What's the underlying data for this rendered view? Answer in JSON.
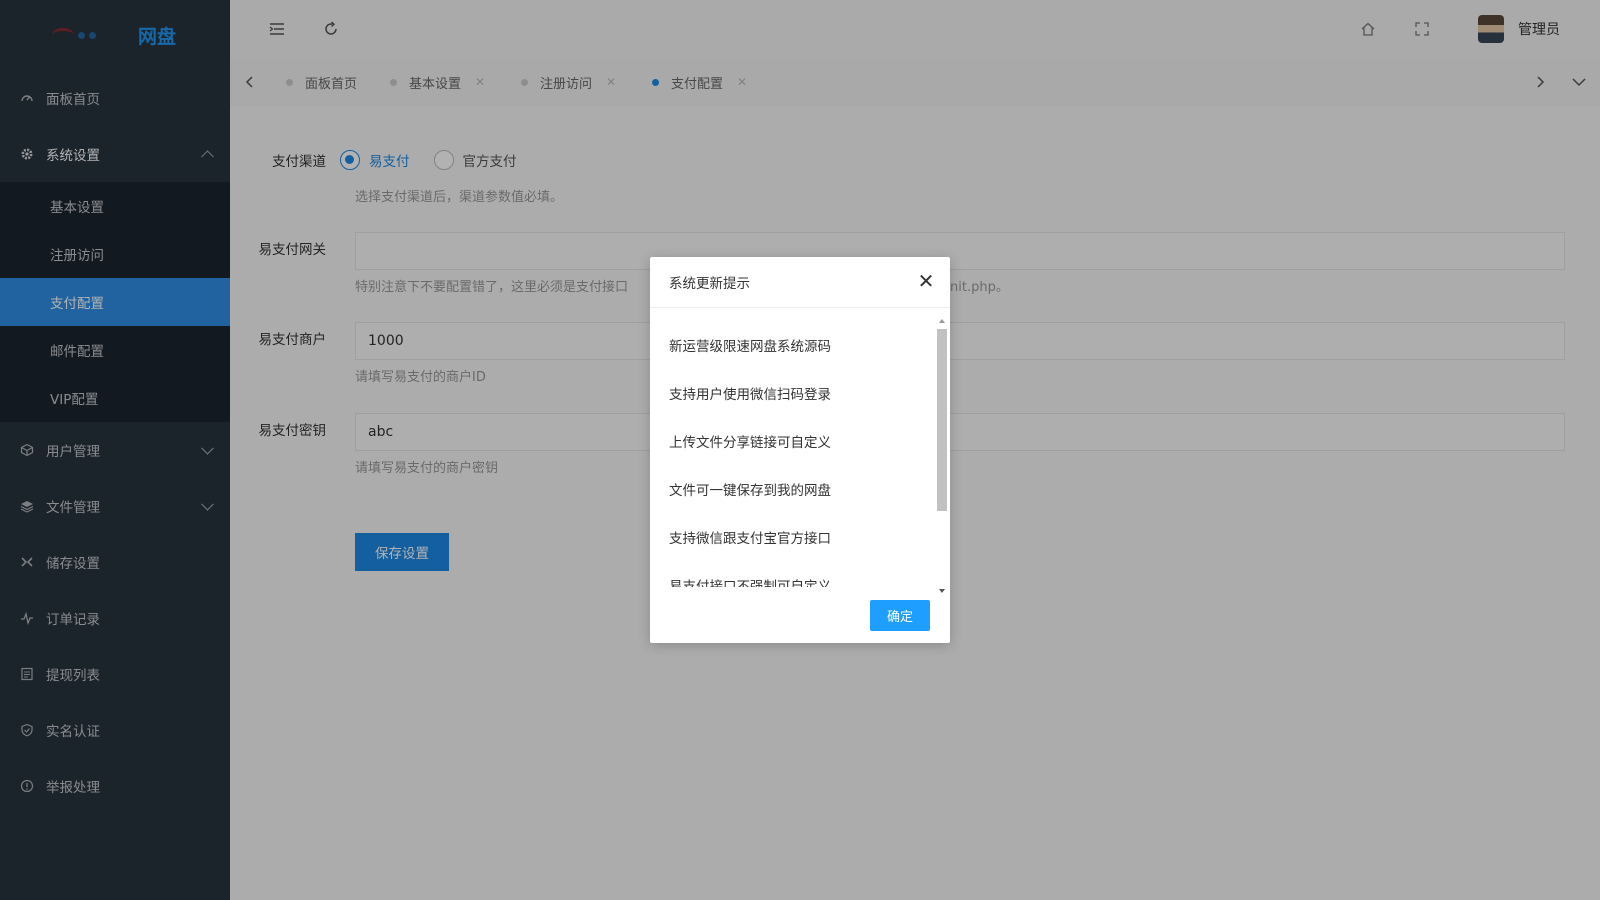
{
  "app": {
    "logo_text": "网盘"
  },
  "sidebar": {
    "items": [
      {
        "label": "面板首页",
        "icon": "dashboard-icon"
      },
      {
        "label": "系统设置",
        "icon": "gear-icon"
      },
      {
        "label": "用户管理",
        "icon": "user-cube-icon"
      },
      {
        "label": "文件管理",
        "icon": "layers-icon"
      },
      {
        "label": "储存设置",
        "icon": "storage-icon"
      },
      {
        "label": "订单记录",
        "icon": "pulse-icon"
      },
      {
        "label": "提现列表",
        "icon": "list-icon"
      },
      {
        "label": "实名认证",
        "icon": "shield-check-icon"
      },
      {
        "label": "举报处理",
        "icon": "info-icon"
      }
    ],
    "submenu": [
      {
        "label": "基本设置"
      },
      {
        "label": "注册访问"
      },
      {
        "label": "支付配置",
        "active": true
      },
      {
        "label": "邮件配置"
      },
      {
        "label": "VIP配置"
      }
    ]
  },
  "header": {
    "user_name": "管理员"
  },
  "tabs": [
    {
      "label": "面板首页"
    },
    {
      "label": "基本设置"
    },
    {
      "label": "注册访问"
    },
    {
      "label": "支付配置",
      "active": true
    }
  ],
  "form": {
    "channel": {
      "label": "支付渠道",
      "options": [
        "易支付",
        "官方支付"
      ],
      "selected": "易支付",
      "hint": "选择支付渠道后，渠道参数值必填。"
    },
    "gateway": {
      "label": "易支付网关",
      "value": "",
      "hint_start": "特别注意下不要配置错了，这里必须是支付接口",
      "hint_end": "nit.php。"
    },
    "merchant": {
      "label": "易支付商户",
      "value": "1000",
      "hint": "请填写易支付的商户ID"
    },
    "secret": {
      "label": "易支付密钥",
      "value": "abc",
      "hint": "请填写易支付的商户密钥"
    },
    "save_label": "保存设置"
  },
  "modal": {
    "title": "系统更新提示",
    "items": [
      "新运营级限速网盘系统源码",
      "支持用户使用微信扫码登录",
      "上传文件分享链接可自定义",
      "文件可一键保存到我的网盘",
      "支持微信跟支付宝官方接口",
      "易支付接口不强制可自定义"
    ],
    "ok_label": "确定"
  },
  "colors": {
    "accent": "#1e88e5",
    "sidebar_bg": "#28333e",
    "modal_button": "#1e9fff"
  }
}
